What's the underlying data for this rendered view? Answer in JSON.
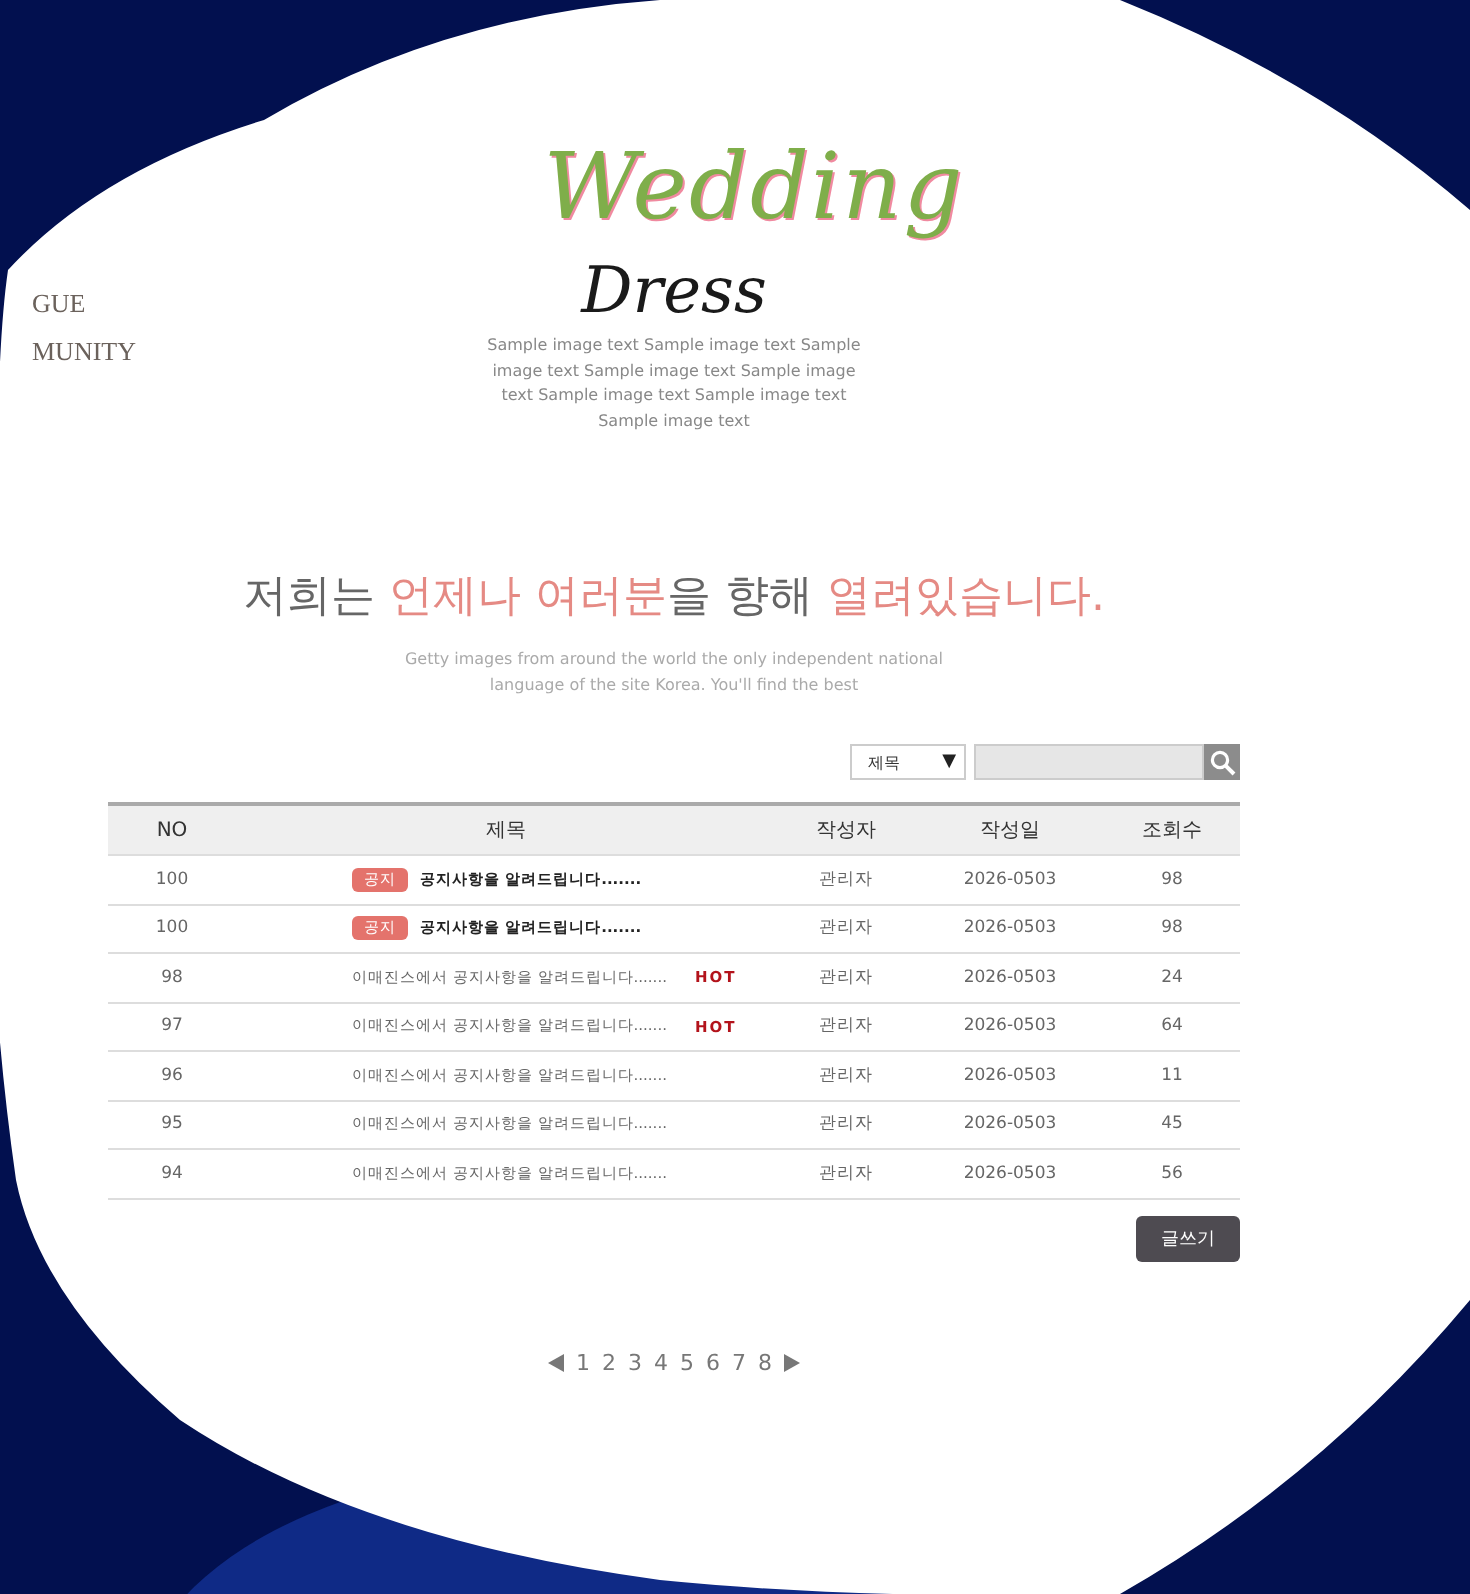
{
  "nav": {
    "items": [
      "GUE",
      "MUNITY"
    ]
  },
  "hero": {
    "script_title": "Wedding",
    "title": "Dress",
    "caption": "Sample image text Sample image text Sample image text Sample image text Sample image text Sample image text Sample image text Sample image text"
  },
  "headline": {
    "segments": [
      {
        "text": "저희는 ",
        "highlight": false
      },
      {
        "text": "언제나 여러분",
        "highlight": true
      },
      {
        "text": "을 향해 ",
        "highlight": false
      },
      {
        "text": "열려있습니다.",
        "highlight": true
      }
    ],
    "subtitle": "Getty images from around the world the only independent national language of the site Korea. You'll find the best"
  },
  "search": {
    "field_select": "제목",
    "dropdown_glyph": "▼"
  },
  "table": {
    "columns": [
      "NO",
      "제목",
      "작성자",
      "작성일",
      "조회수"
    ],
    "rows": [
      {
        "kind": "notice",
        "no": "100",
        "badge": "공지",
        "title": "공지사항을 알려드립니다.......",
        "author": "관리자",
        "date": "2026-0503",
        "views": "98"
      },
      {
        "kind": "notice",
        "no": "100",
        "badge": "공지",
        "title": "공지사항을 알려드립니다.......",
        "author": "관리자",
        "date": "2026-0503",
        "views": "98"
      },
      {
        "kind": "post",
        "no": "98",
        "title": "이매진스에서 공지사항을 알려드립니다.......",
        "hot": "HOT",
        "author": "관리자",
        "date": "2026-0503",
        "views": "24"
      },
      {
        "kind": "post",
        "no": "97",
        "title": "이매진스에서 공지사항을 알려드립니다.......",
        "hot": "HOT",
        "author": "관리자",
        "date": "2026-0503",
        "views": "64"
      },
      {
        "kind": "post",
        "no": "96",
        "title": "이매진스에서 공지사항을 알려드립니다.......",
        "author": "관리자",
        "date": "2026-0503",
        "views": "11"
      },
      {
        "kind": "post",
        "no": "95",
        "title": "이매진스에서 공지사항을 알려드립니다.......",
        "author": "관리자",
        "date": "2026-0503",
        "views": "45"
      },
      {
        "kind": "post",
        "no": "94",
        "title": "이매진스에서 공지사항을 알려드립니다.......",
        "author": "관리자",
        "date": "2026-0503",
        "views": "56"
      }
    ]
  },
  "write_button": "글쓰기",
  "pagination": {
    "pages": [
      "1",
      "2",
      "3",
      "4",
      "5",
      "6",
      "7",
      "8"
    ]
  }
}
